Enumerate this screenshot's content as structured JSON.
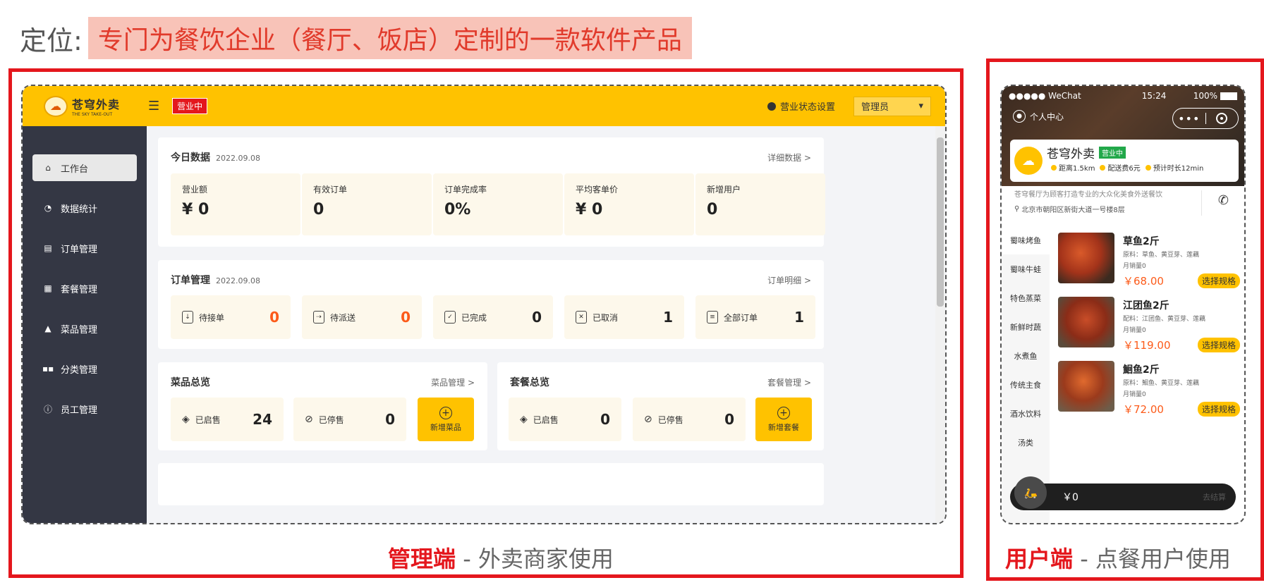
{
  "slide": {
    "prefix": "定位:",
    "highlight": "专门为餐饮企业（餐厅、饭店）定制的一款软件产品",
    "caption_admin_hl": "管理端",
    "caption_admin_rest": " - 外卖商家使用",
    "caption_user_hl": "用户端",
    "caption_user_rest": " - 点餐用户使用"
  },
  "admin": {
    "logo_cn": "苍穹外卖",
    "logo_en": "THE SKY TAKE-OUT",
    "status_badge": "营业中",
    "status_setting": "营业状态设置",
    "user_select": "管理员",
    "sidebar": [
      {
        "label": "工作台",
        "icon": "home-icon"
      },
      {
        "label": "数据统计",
        "icon": "chart-icon"
      },
      {
        "label": "订单管理",
        "icon": "clipboard-icon"
      },
      {
        "label": "套餐管理",
        "icon": "gift-icon"
      },
      {
        "label": "菜品管理",
        "icon": "dish-icon"
      },
      {
        "label": "分类管理",
        "icon": "grid-icon"
      },
      {
        "label": "员工管理",
        "icon": "info-icon"
      }
    ],
    "today": {
      "title": "今日数据",
      "date": "2022.09.08",
      "link": "详细数据 >",
      "stats": [
        {
          "label": "营业额",
          "value": "¥ 0"
        },
        {
          "label": "有效订单",
          "value": "0"
        },
        {
          "label": "订单完成率",
          "value": "0%"
        },
        {
          "label": "平均客单价",
          "value": "¥ 0"
        },
        {
          "label": "新增用户",
          "value": "0"
        }
      ]
    },
    "orders": {
      "title": "订单管理",
      "date": "2022.09.08",
      "link": "订单明细 >",
      "tiles": [
        {
          "label": "待接单",
          "value": "0",
          "highlight": true
        },
        {
          "label": "待派送",
          "value": "0",
          "highlight": true
        },
        {
          "label": "已完成",
          "value": "0",
          "highlight": false
        },
        {
          "label": "已取消",
          "value": "1",
          "highlight": false
        },
        {
          "label": "全部订单",
          "value": "1",
          "highlight": false
        }
      ]
    },
    "dishes": {
      "title": "菜品总览",
      "link": "菜品管理 >",
      "on_label": "已启售",
      "on_value": "24",
      "off_label": "已停售",
      "off_value": "0",
      "add_label": "新增菜品"
    },
    "combos": {
      "title": "套餐总览",
      "link": "套餐管理 >",
      "on_label": "已启售",
      "on_value": "0",
      "off_label": "已停售",
      "off_value": "0",
      "add_label": "新增套餐"
    }
  },
  "phone": {
    "carrier": "●●●●● WeChat",
    "time": "15:24",
    "battery": "100%",
    "profile": "个人中心",
    "shop_name": "苍穹外卖",
    "shop_status": "营业中",
    "meta": [
      "距离1.5km",
      "配送费6元",
      "预计时长12min"
    ],
    "desc": "苍穹餐厅为顾客打造专业的大众化美食外送餐饮",
    "address": "北京市朝阳区新街大道一号楼8层",
    "categories": [
      "蜀味烤鱼",
      "蜀味牛蛙",
      "特色蒸菜",
      "新鲜时蔬",
      "水煮鱼",
      "传统主食",
      "酒水饮料",
      "汤类"
    ],
    "dishes": [
      {
        "name": "草鱼2斤",
        "ingredients": "原料：草鱼、黄豆芽、莲藕",
        "sold": "月销量0",
        "price": "￥68.00",
        "button": "选择规格"
      },
      {
        "name": "江团鱼2斤",
        "ingredients": "配料：江团鱼、黄豆芽、莲藕",
        "sold": "月销量0",
        "price": "￥119.00",
        "button": "选择规格"
      },
      {
        "name": "鮰鱼2斤",
        "ingredients": "原料：鮰鱼、黄豆芽、莲藕",
        "sold": "月销量0",
        "price": "￥72.00",
        "button": "选择规格"
      }
    ],
    "cart_total": "￥0",
    "cart_submit": "去结算"
  },
  "colors": {
    "brand_yellow": "#ffc200",
    "sidebar_dark": "#343744",
    "frame_red": "#e4171d",
    "accent_orange": "#fc5b1a",
    "open_green": "#22a84a"
  }
}
